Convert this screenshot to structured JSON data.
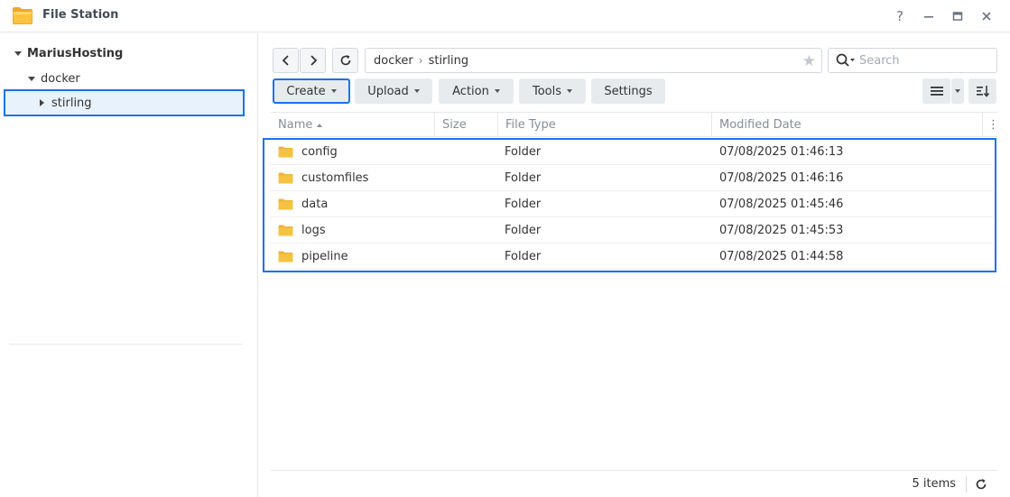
{
  "window": {
    "title": "File Station",
    "controls": {
      "help": "?",
      "minimize": "–",
      "maximize": "□",
      "close": "✕"
    }
  },
  "sidebar": {
    "root": "MariusHosting",
    "folder": "docker",
    "selected": "stirling"
  },
  "toolbar": {
    "path": [
      "docker",
      "stirling"
    ],
    "search_placeholder": "Search",
    "buttons": {
      "create": "Create",
      "upload": "Upload",
      "action": "Action",
      "tools": "Tools",
      "settings": "Settings"
    }
  },
  "table": {
    "columns": {
      "name": "Name",
      "size": "Size",
      "type": "File Type",
      "modified": "Modified Date"
    },
    "rows": [
      {
        "name": "config",
        "size": "",
        "type": "Folder",
        "modified": "07/08/2025 01:46:13"
      },
      {
        "name": "customfiles",
        "size": "",
        "type": "Folder",
        "modified": "07/08/2025 01:46:16"
      },
      {
        "name": "data",
        "size": "",
        "type": "Folder",
        "modified": "07/08/2025 01:45:46"
      },
      {
        "name": "logs",
        "size": "",
        "type": "Folder",
        "modified": "07/08/2025 01:45:53"
      },
      {
        "name": "pipeline",
        "size": "",
        "type": "Folder",
        "modified": "07/08/2025 01:44:58"
      }
    ]
  },
  "status": {
    "count": "5 items"
  },
  "colors": {
    "accent": "#1a73e8",
    "folder": "#f5c242",
    "button_bg": "#e8ebee"
  }
}
